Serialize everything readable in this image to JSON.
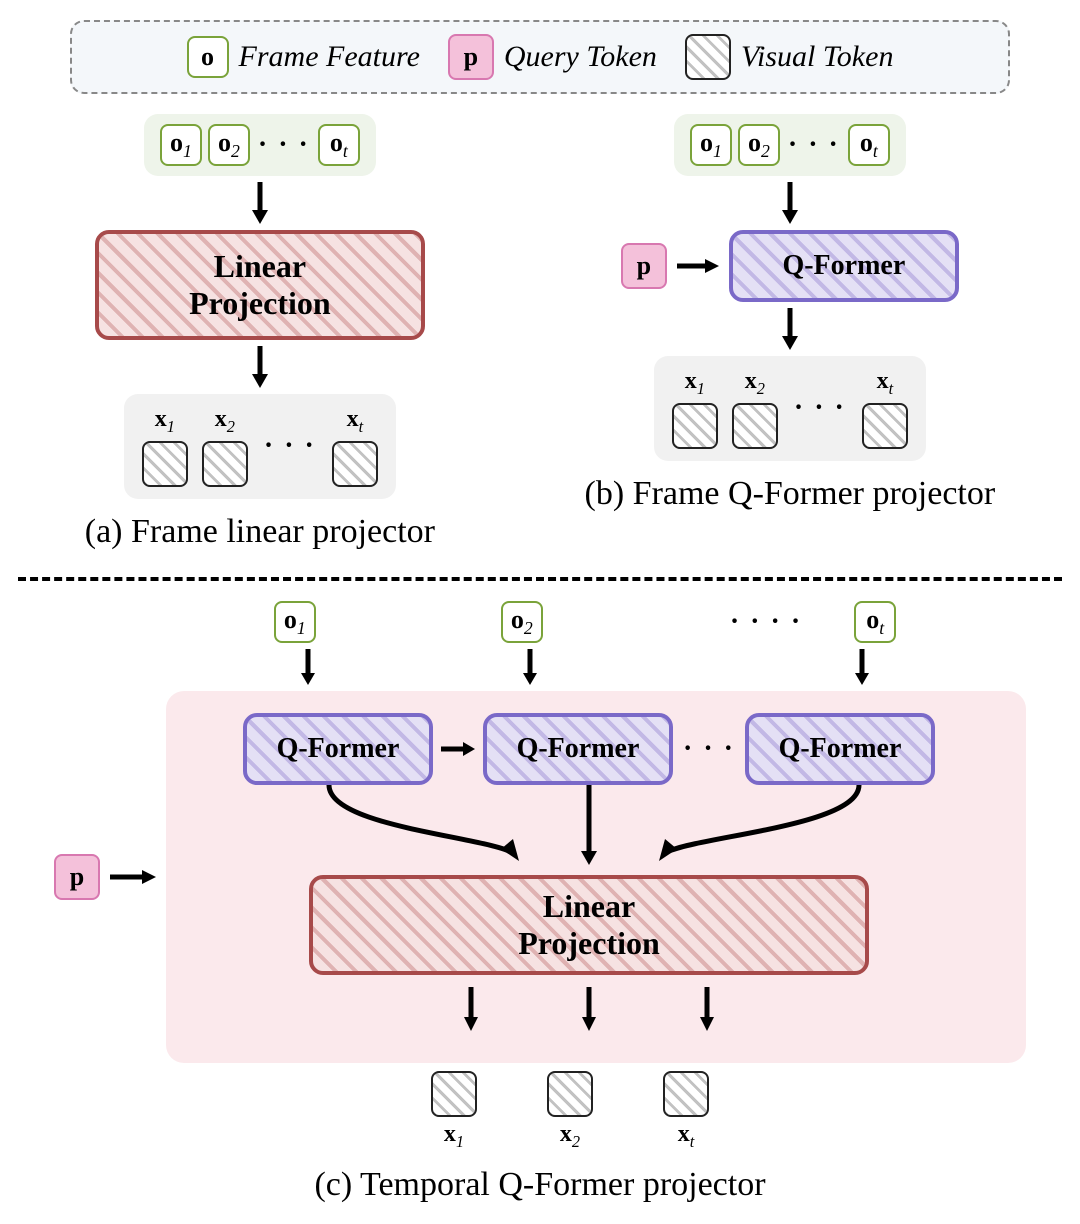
{
  "legend": {
    "frame_feature_symbol": "o",
    "frame_feature_label": "Frame Feature",
    "query_token_symbol": "p",
    "query_token_label": "Query Token",
    "visual_token_label": "Visual Token"
  },
  "panels": {
    "a": {
      "inputs": [
        "o₁",
        "o₂",
        "oₜ"
      ],
      "ellipsis": "· · ·",
      "block": "Linear Projection",
      "outputs": [
        "x₁",
        "x₂",
        "xₜ"
      ],
      "out_ellipsis": "· · ·",
      "caption": "(a) Frame linear projector"
    },
    "b": {
      "inputs": [
        "o₁",
        "o₂",
        "oₜ"
      ],
      "ellipsis": "· · ·",
      "query": "p",
      "block": "Q-Former",
      "outputs": [
        "x₁",
        "x₂",
        "xₜ"
      ],
      "out_ellipsis": "· · ·",
      "caption": "(b) Frame Q-Former projector"
    },
    "c": {
      "query": "p",
      "inputs": [
        "o₁",
        "o₂",
        "oₜ"
      ],
      "ellipsis_top": "· · · ·",
      "qformers": [
        "Q-Former",
        "Q-Former",
        "Q-Former"
      ],
      "mid_ellipsis": "· · ·",
      "linear": "Linear Projection",
      "outputs": [
        "x₁",
        "x₂",
        "xₜ"
      ],
      "caption": "(c) Temporal Q-Former projector"
    }
  }
}
